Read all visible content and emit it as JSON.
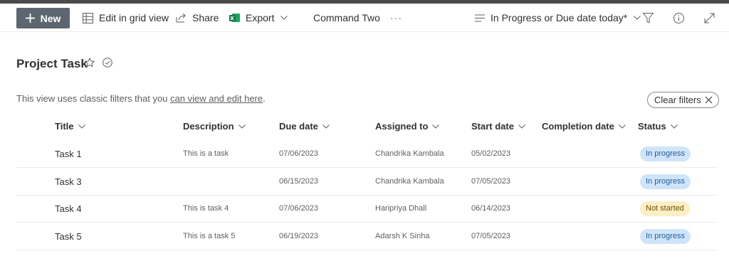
{
  "toolbar": {
    "new_label": "New",
    "grid_label": "Edit in grid view",
    "share_label": "Share",
    "export_label": "Export",
    "command_two_label": "Command Two",
    "more_label": "···",
    "view_label": "In Progress or Due date today*"
  },
  "page": {
    "title": "Project Task"
  },
  "filter_info": {
    "text": "This view uses classic filters that you ",
    "link": "can view and edit here",
    "suffix": ".",
    "clear_label": "Clear filters"
  },
  "columns": [
    "Title",
    "Description",
    "Due date",
    "Assigned to",
    "Start date",
    "Completion date",
    "Status"
  ],
  "rows": [
    {
      "title": "Task 1",
      "description": "This is a task",
      "due": "07/06/2023",
      "assigned": "Chandrika Kambala",
      "start": "05/02/2023",
      "completion": "",
      "status": "In progress"
    },
    {
      "title": "Task 3",
      "description": "",
      "due": "06/15/2023",
      "assigned": "Chandrika Kambala",
      "start": "07/05/2023",
      "completion": "",
      "status": "In progress"
    },
    {
      "title": "Task 4",
      "description": "This is task 4",
      "due": "07/06/2023",
      "assigned": "Haripriya Dhall",
      "start": "06/14/2023",
      "completion": "",
      "status": "Not started"
    },
    {
      "title": "Task 5",
      "description": "This is a task 5",
      "due": "06/19/2023",
      "assigned": "Adarsh K Sinha",
      "start": "07/05/2023",
      "completion": "",
      "status": "In progress"
    }
  ],
  "status_colors": {
    "In progress": {
      "bg": "#cfe4fa",
      "fg": "#1f5f99"
    },
    "Not started": {
      "bg": "#fcefc4",
      "fg": "#6b5200"
    }
  },
  "icons": [
    "plus-icon",
    "grid-icon",
    "share-icon",
    "excel-icon",
    "chevron-down-icon",
    "view-lines-icon",
    "filter-icon",
    "info-icon",
    "expand-icon",
    "star-icon",
    "check-circle-icon",
    "close-icon"
  ]
}
